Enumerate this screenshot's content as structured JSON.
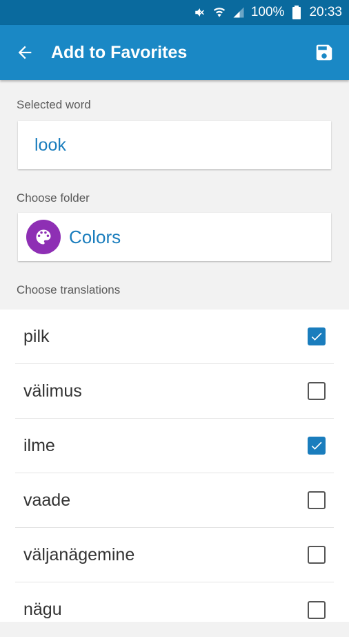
{
  "status_bar": {
    "battery": "100%",
    "time": "20:33",
    "icons": [
      "mute-icon",
      "wifi-icon",
      "signal-icon",
      "battery-icon"
    ]
  },
  "app_bar": {
    "title": "Add to Favorites",
    "back_icon": "arrow-back-icon",
    "save_icon": "save-icon"
  },
  "selected_word": {
    "label": "Selected word",
    "value": "look"
  },
  "folder": {
    "label": "Choose folder",
    "name": "Colors",
    "icon": "palette-icon",
    "icon_color": "#8e2fb4"
  },
  "translations": {
    "label": "Choose translations",
    "items": [
      {
        "word": "pilk",
        "checked": true
      },
      {
        "word": "välimus",
        "checked": false
      },
      {
        "word": "ilme",
        "checked": true
      },
      {
        "word": "vaade",
        "checked": false
      },
      {
        "word": "väljanägemine",
        "checked": false
      },
      {
        "word": "nägu",
        "checked": false
      }
    ]
  },
  "colors": {
    "accent": "#1a88c5",
    "status_bar": "#0a6a9e",
    "link": "#1a7dbd"
  }
}
